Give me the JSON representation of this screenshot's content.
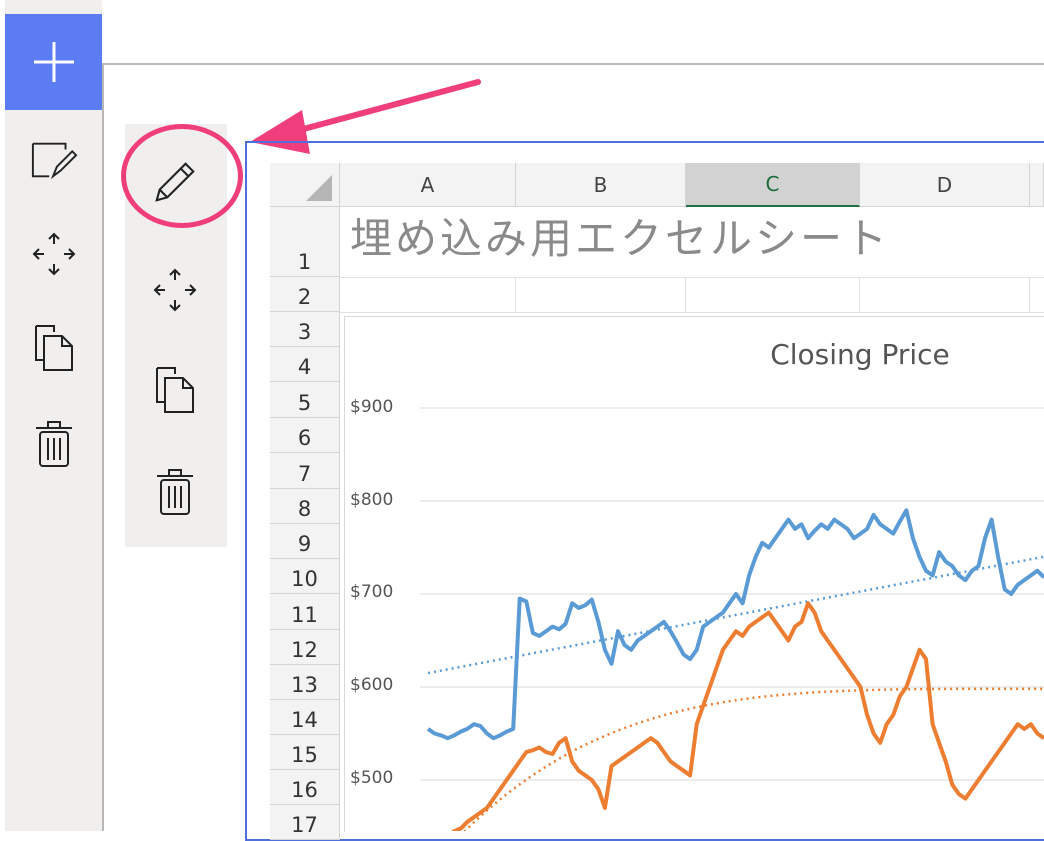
{
  "left_toolbar": {
    "add_label": "+",
    "tools": [
      {
        "name": "edit-shape-icon"
      },
      {
        "name": "move-icon"
      },
      {
        "name": "copy-icon"
      },
      {
        "name": "trash-icon"
      }
    ]
  },
  "inner_toolbar": {
    "tools": [
      {
        "name": "pencil-icon"
      },
      {
        "name": "move-icon"
      },
      {
        "name": "copy-icon"
      },
      {
        "name": "trash-icon"
      }
    ]
  },
  "sheet": {
    "columns": [
      "A",
      "B",
      "C",
      "D"
    ],
    "selected_column": "C",
    "rows": [
      "1",
      "2",
      "3",
      "4",
      "5",
      "6",
      "7",
      "8",
      "9",
      "10",
      "11",
      "12",
      "13",
      "14",
      "15",
      "16",
      "17"
    ],
    "title_cell": "埋め込み用エクセルシート"
  },
  "colors": {
    "accent_blue": "#5b7cf2",
    "callout_pink": "#f03d7b",
    "series_blue": "#5b9bd5",
    "series_orange": "#ed7d31"
  },
  "chart_data": {
    "type": "line",
    "title": "Closing Price",
    "ylabel": "",
    "xlabel": "",
    "yticks": [
      "$900",
      "$800",
      "$700",
      "$600",
      "$500"
    ],
    "ylim": [
      440,
      920
    ],
    "grid": true,
    "series": [
      {
        "values": [
          555,
          550,
          548,
          545,
          548,
          552,
          555,
          560,
          558,
          550,
          545,
          548,
          552,
          555,
          695,
          692,
          658,
          655,
          660,
          665,
          662,
          668,
          690,
          685,
          688,
          694,
          670,
          640,
          625,
          660,
          645,
          640,
          650,
          655,
          660,
          665,
          670,
          660,
          648,
          635,
          630,
          640,
          665,
          670,
          675,
          680,
          690,
          700,
          690,
          720,
          740,
          755,
          750,
          760,
          770,
          780,
          770,
          775,
          760,
          768,
          775,
          770,
          780,
          775,
          770,
          760,
          765,
          770,
          785,
          775,
          770,
          765,
          778,
          790,
          760,
          740,
          725,
          720,
          745,
          735,
          730,
          720,
          715,
          725,
          730,
          760,
          780,
          740,
          705,
          700,
          710,
          715,
          720,
          725,
          718
        ],
        "trend": [
          615,
          740
        ]
      },
      {
        "values": [
          440,
          435,
          438,
          440,
          445,
          448,
          455,
          460,
          465,
          470,
          480,
          490,
          500,
          510,
          520,
          530,
          532,
          535,
          530,
          528,
          540,
          545,
          520,
          510,
          505,
          500,
          490,
          470,
          515,
          520,
          525,
          530,
          535,
          540,
          545,
          540,
          530,
          520,
          515,
          510,
          505,
          560,
          580,
          600,
          620,
          640,
          650,
          660,
          655,
          665,
          670,
          675,
          680,
          670,
          660,
          650,
          665,
          670,
          690,
          680,
          660,
          650,
          640,
          630,
          620,
          610,
          600,
          570,
          550,
          540,
          560,
          570,
          590,
          600,
          620,
          640,
          630,
          560,
          540,
          520,
          495,
          485,
          480,
          490,
          500,
          510,
          520,
          530,
          540,
          550,
          560,
          555,
          560,
          550,
          545
        ],
        "trend": [
          440,
          598
        ]
      }
    ]
  }
}
